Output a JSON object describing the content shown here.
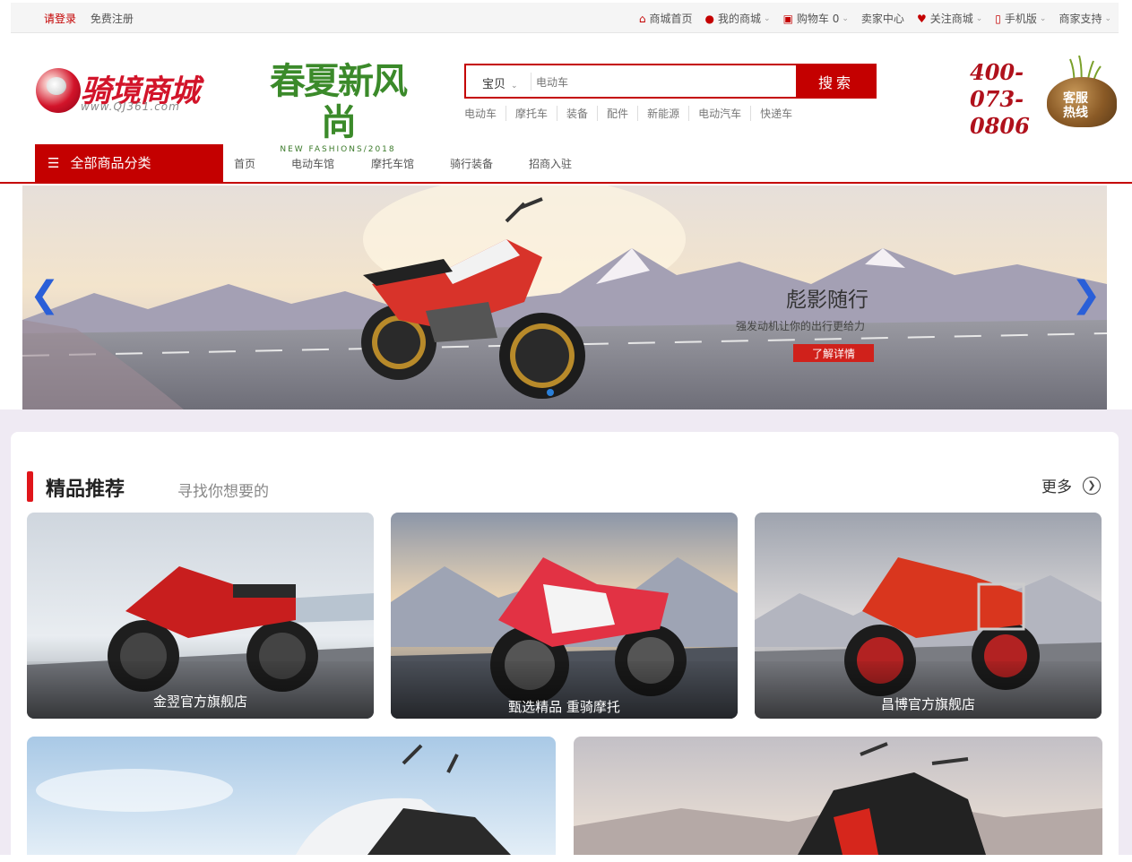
{
  "topbar": {
    "login": "请登录",
    "register": "免费注册",
    "items": [
      {
        "icon": "home-icon",
        "label": "商城首页",
        "dropdown": false
      },
      {
        "icon": "user-icon",
        "label": "我的商城",
        "dropdown": true
      },
      {
        "icon": "cart-icon",
        "label": "购物车 0",
        "dropdown": true
      },
      {
        "icon": "",
        "label": "卖家中心",
        "dropdown": false
      },
      {
        "icon": "heart-icon",
        "label": "关注商城",
        "dropdown": true
      },
      {
        "icon": "phone-icon",
        "label": "手机版",
        "dropdown": true
      },
      {
        "icon": "",
        "label": "商家支持",
        "dropdown": true
      }
    ]
  },
  "header": {
    "logo_text": "骑境商城",
    "logo_url": "www.QJ361.com",
    "slogan_big": "春夏新风尚",
    "slogan_small": "NEW FASHIONS/2018",
    "hotline_number": "400-073-0806",
    "hotline_label": "客服热线"
  },
  "search": {
    "category": "宝贝",
    "placeholder": "电动车",
    "button": "搜索",
    "hot_keywords": [
      "电动车",
      "摩托车",
      "装备",
      "配件",
      "新能源",
      "电动汽车",
      "快递车"
    ]
  },
  "nav": {
    "all_categories": "全部商品分类",
    "links": [
      "首页",
      "电动车馆",
      "摩托车馆",
      "骑行装备",
      "招商入驻"
    ]
  },
  "banner": {
    "title": "彪影随行",
    "subtitle": "强发动机让你的出行更给力",
    "button": "了解详情",
    "slide_count": 1,
    "active_slide": 1
  },
  "recommend": {
    "title": "精品推荐",
    "subtitle": "寻找你想要的",
    "more": "更多",
    "tiles": [
      {
        "label": "金翌官方旗舰店"
      },
      {
        "label": "甄选精品 重骑摩托"
      },
      {
        "label": "昌博官方旗舰店"
      }
    ]
  },
  "colors": {
    "brand_red": "#c40000",
    "accent_blue": "#2a5fd8",
    "section_bg": "#efeaf3"
  }
}
